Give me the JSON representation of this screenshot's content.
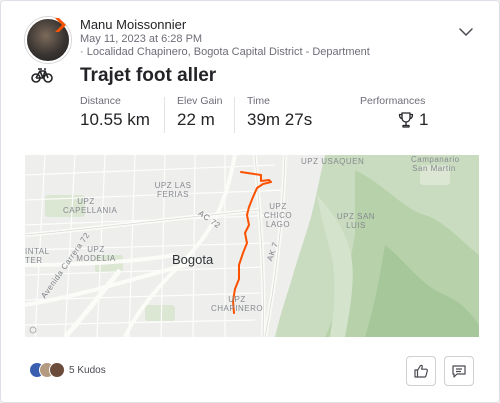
{
  "athlete": {
    "name": "Manu Moissonnier",
    "timestamp": "May 11, 2023 at 6:28 PM",
    "location": "· Localidad Chapinero, Bogota Capital District - Department"
  },
  "activity": {
    "title": "Trajet foot aller",
    "sport_icon": "bike-icon"
  },
  "stats": [
    {
      "label": "Distance",
      "value": "10.55 km"
    },
    {
      "label": "Elev Gain",
      "value": "22 m"
    },
    {
      "label": "Time",
      "value": "39m 27s"
    }
  ],
  "performances": {
    "label": "Performances",
    "value": "1",
    "icon": "trophy-icon"
  },
  "map": {
    "city_label": "Bogota",
    "labels": [
      "UPZ USAQUEN",
      "Campanario San Martin",
      "UPZ LAS FERIAS",
      "UPZ CAPELLANIA",
      "UPZ CHICO LAGO",
      "UPZ SAN LUIS",
      "UPZ MODELIA",
      "UPZ CHAPINERO",
      "INTAL TER",
      "AC 72",
      "AK 7",
      "Avenida Carrera 72"
    ],
    "route_color": "#fc5200"
  },
  "kudos": {
    "count_label": "5 Kudos"
  },
  "actions": {
    "kudos_icon": "thumbs-up-icon",
    "comment_icon": "comment-icon"
  }
}
